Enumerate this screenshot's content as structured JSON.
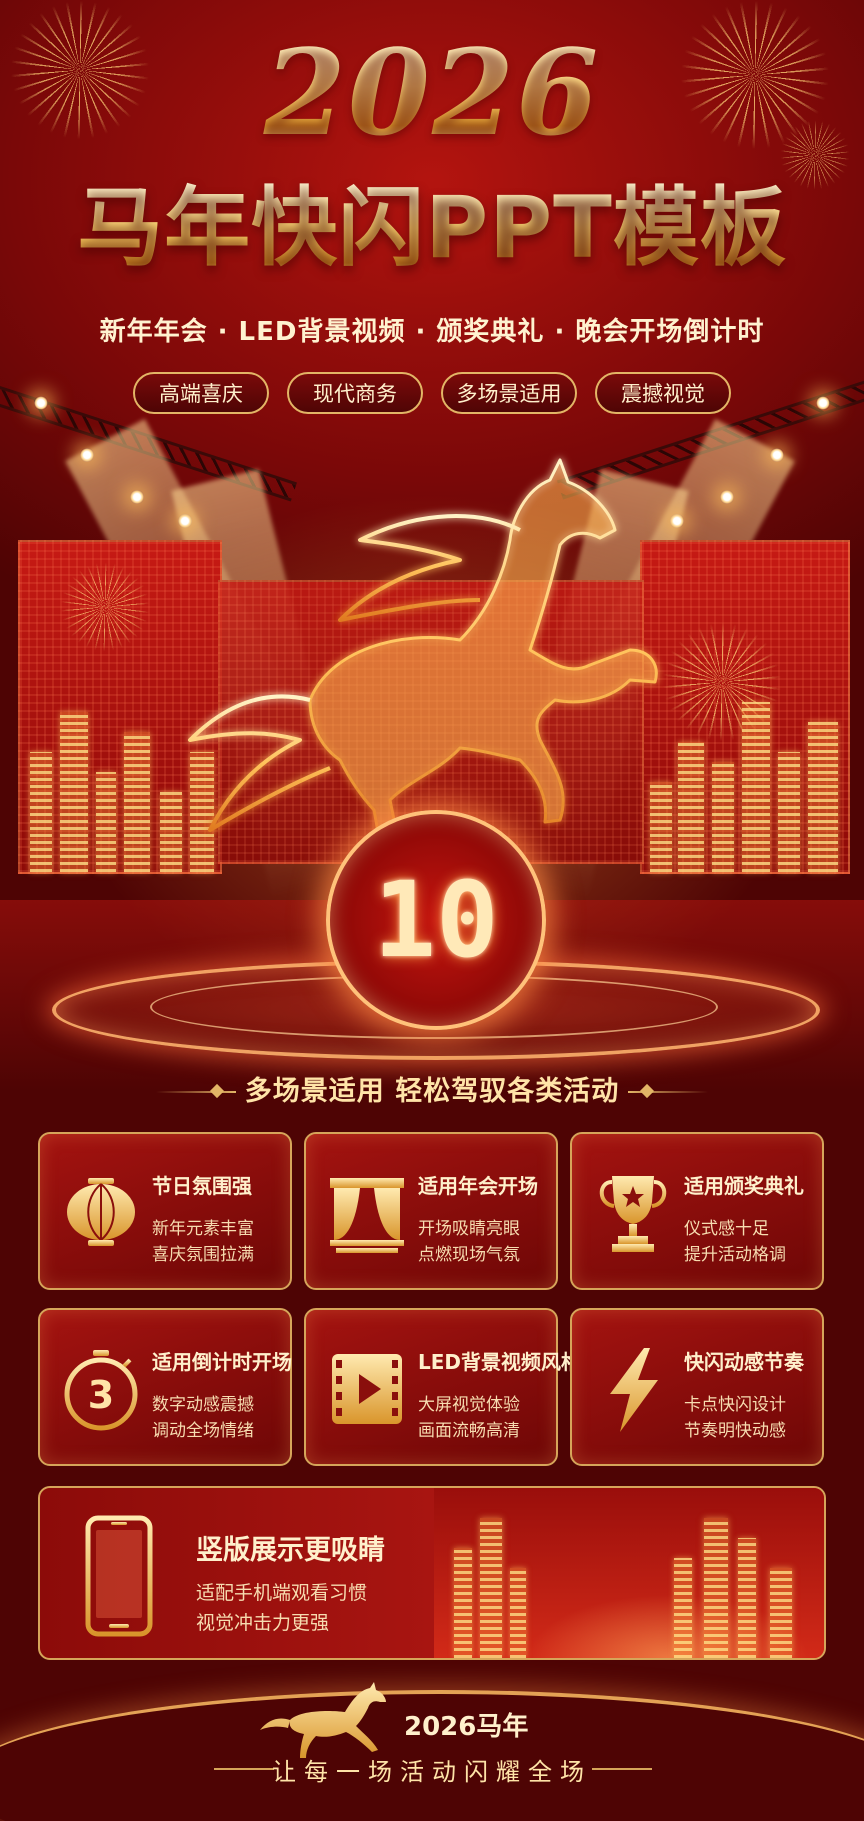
{
  "header": {
    "year": "2026",
    "title": "马年快闪PPT模板",
    "subtitle": "新年年会 · LED背景视频 · 颁奖典礼 · 晚会开场倒计时",
    "tags": [
      "高端喜庆",
      "现代商务",
      "多场景适用",
      "震撼视觉"
    ]
  },
  "stage": {
    "countdown": "10"
  },
  "features": {
    "section_title": "多场景适用 轻松驾驭各类活动",
    "cards": [
      {
        "icon": "lantern-icon",
        "title": "节日氛围强",
        "line1": "新年元素丰富",
        "line2": "喜庆氛围拉满"
      },
      {
        "icon": "stage-curtain-icon",
        "title": "适用年会开场",
        "line1": "开场吸睛亮眼",
        "line2": "点燃现场气氛"
      },
      {
        "icon": "trophy-icon",
        "title": "适用颁奖典礼",
        "line1": "仪式感十足",
        "line2": "提升活动格调"
      },
      {
        "icon": "countdown-timer-icon",
        "title": "适用倒计时开场",
        "line1": "数字动感震撼",
        "line2": "调动全场情绪"
      },
      {
        "icon": "video-play-icon",
        "title": "LED背景视频风格",
        "line1": "大屏视觉体验",
        "line2": "画面流畅高清"
      },
      {
        "icon": "lightning-icon",
        "title": "快闪动感节奏",
        "line1": "卡点快闪设计",
        "line2": "节奏明快动感"
      }
    ],
    "big_card": {
      "icon": "smartphone-icon",
      "title": "竖版展示更吸睛",
      "line1": "适配手机端观看习惯",
      "line2": "视觉冲击力更强"
    },
    "timer_digit": "3"
  },
  "footer": {
    "year_text": "2026马年",
    "slogan": "让每一场活动闪耀全场"
  },
  "colors": {
    "background": "#5a0606",
    "accent_gold": "#e3b566",
    "red": "#b3140f"
  }
}
